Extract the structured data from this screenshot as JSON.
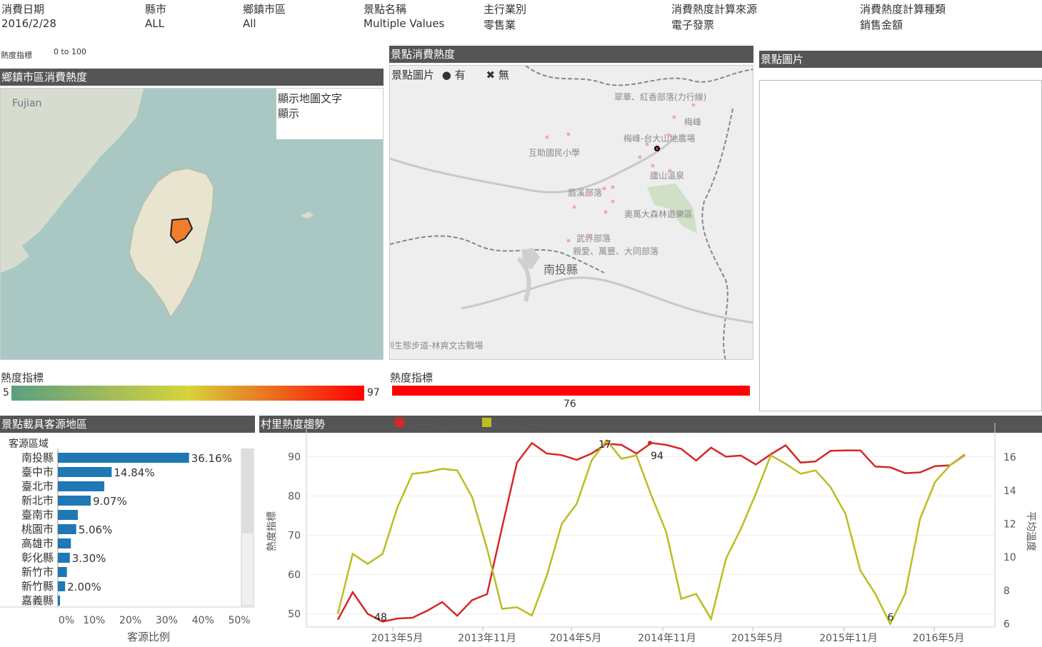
{
  "filters": [
    {
      "label": "消費日期",
      "value": "2016/2/28"
    },
    {
      "label": "縣市",
      "value": "ALL"
    },
    {
      "label": "鄉鎮市區",
      "value": "All"
    },
    {
      "label": "景點名稱",
      "value": "Multiple Values"
    },
    {
      "label": "主行業別",
      "value": "零售業"
    },
    {
      "label": "消費熱度計算來源",
      "value": "電子發票"
    },
    {
      "label": "消費熱度計算種類",
      "value": "銷售金額"
    }
  ],
  "heat_index": {
    "label": "熱度指標",
    "range": "0 to 100"
  },
  "town_map": {
    "title": "鄉鎮市區消費熱度",
    "region_label": "Fujian",
    "toggle_label": "顯示地圖文字",
    "toggle_value": "顯示",
    "legend_title": "熱度指標",
    "legend_min": "5",
    "legend_max": "97"
  },
  "spot_map": {
    "title": "景點消費熱度",
    "legend_label": "景點圖片",
    "legend_yes": "有",
    "legend_no": "無",
    "place_labels": [
      "翠華、紅香部落(力行線)",
      "梅峰",
      "梅峰-台大山地農場",
      "互助國民小學",
      "廬山溫泉",
      "眉溪部落",
      "奧萬大森林遊樂區",
      "武界部落",
      "親愛、萬豐、大同部落",
      "南投縣",
      "高源圳生態步道-林爽文古戰場"
    ],
    "legend_title": "熱度指標",
    "legend_value": "76"
  },
  "spot_photo": {
    "title": "景點圖片"
  },
  "origin_chart": {
    "title": "景點載具客源地區",
    "column_header": "客源區域",
    "x_label": "客源比例",
    "x_ticks": [
      "0%",
      "10%",
      "20%",
      "30%",
      "40%",
      "50%"
    ]
  },
  "trend_chart": {
    "title": "村里熱度趨勢",
    "legend": [
      {
        "name": "熱度指標",
        "color": "#d62728"
      },
      {
        "name": "平均溫度",
        "color": "#bcbd22"
      }
    ],
    "y_left_label": "熱度指標",
    "y_right_label": "平均溫度",
    "y_left_ticks": [
      "50",
      "60",
      "70",
      "80",
      "90"
    ],
    "y_right_ticks": [
      "6",
      "8",
      "10",
      "12",
      "14",
      "16"
    ],
    "x_ticks": [
      "2013年5月",
      "2013年11月",
      "2014年5月",
      "2014年11月",
      "2015年5月",
      "2015年11月",
      "2016年5月"
    ],
    "annotations": [
      "48",
      "17",
      "94",
      "6"
    ]
  },
  "chart_data": [
    {
      "type": "bar",
      "title": "景點載具客源地區",
      "xlabel": "客源比例",
      "ylabel": "客源區域",
      "categories": [
        "南投縣",
        "臺中市",
        "臺北市",
        "新北市",
        "臺南市",
        "桃園市",
        "高雄市",
        "彰化縣",
        "新竹市",
        "新竹縣",
        "嘉義縣"
      ],
      "values": [
        36.16,
        14.84,
        12.8,
        9.07,
        5.5,
        5.06,
        3.6,
        3.3,
        2.5,
        2.0,
        0.6
      ],
      "value_labels": [
        "36.16%",
        "14.84%",
        "",
        "9.07%",
        "",
        "5.06%",
        "",
        "3.30%",
        "",
        "2.00%",
        ""
      ],
      "xlim": [
        0,
        50
      ],
      "color": "#1f77b4"
    },
    {
      "type": "line",
      "title": "村里熱度趨勢",
      "x": [
        "2013-03",
        "2013-04",
        "2013-05",
        "2013-06",
        "2013-07",
        "2013-08",
        "2013-09",
        "2013-10",
        "2013-11",
        "2013-12",
        "2014-01",
        "2014-02",
        "2014-03",
        "2014-04",
        "2014-05",
        "2014-06",
        "2014-07",
        "2014-08",
        "2014-09",
        "2014-10",
        "2014-11",
        "2014-12",
        "2015-01",
        "2015-02",
        "2015-03",
        "2015-04",
        "2015-05",
        "2015-06",
        "2015-07",
        "2015-08",
        "2015-09",
        "2015-10",
        "2015-11",
        "2015-12",
        "2016-01",
        "2016-02",
        "2016-03",
        "2016-04",
        "2016-05",
        "2016-06"
      ],
      "xlabel": "",
      "series": [
        {
          "name": "熱度指標",
          "axis": "left",
          "color": "#d62728",
          "values": [
            48.5,
            55.5,
            50.0,
            48.0,
            48.8,
            49.0,
            50.8,
            53.0,
            49.5,
            53.5,
            55.0,
            72.0,
            88.5,
            93.5,
            90.8,
            90.4,
            89.2,
            90.8,
            93.3,
            93.0,
            90.8,
            93.5,
            93.0,
            92.0,
            89.0,
            92.3,
            90.0,
            90.3,
            88.0,
            90.6,
            92.9,
            88.5,
            88.8,
            91.5,
            91.6,
            91.6,
            87.5,
            87.3,
            85.8,
            86.0,
            87.6,
            87.8,
            90.5
          ]
        },
        {
          "name": "平均溫度",
          "axis": "right",
          "color": "#bcbd22",
          "values": [
            6.6,
            10.2,
            9.6,
            10.2,
            13.0,
            15.0,
            15.1,
            15.3,
            15.2,
            13.6,
            10.5,
            6.9,
            7.0,
            6.5,
            8.9,
            12.0,
            13.2,
            15.8,
            17.0,
            15.9,
            16.1,
            13.7,
            11.5,
            7.5,
            7.8,
            6.3,
            9.9,
            11.7,
            13.8,
            16.1,
            15.6,
            15.0,
            15.2,
            14.2,
            12.6,
            9.2,
            7.8,
            6.0,
            7.8,
            12.3,
            14.5,
            15.5,
            16.1
          ]
        }
      ],
      "y_left_lim": [
        47,
        95
      ],
      "y_right_lim": [
        5.9,
        17.2
      ],
      "annotations": [
        {
          "series": "熱度指標",
          "label": "48"
        },
        {
          "series": "平均溫度",
          "label": "17"
        },
        {
          "series": "熱度指標",
          "label": "94"
        },
        {
          "series": "平均溫度",
          "label": "6"
        }
      ]
    }
  ]
}
